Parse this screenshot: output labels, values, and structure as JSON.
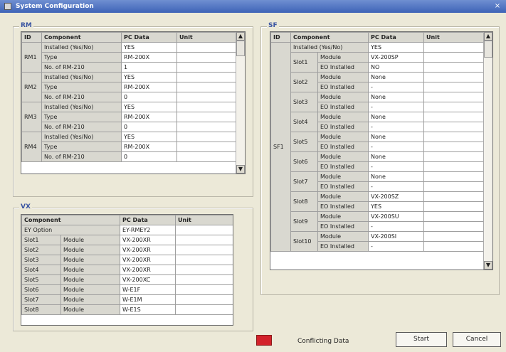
{
  "window": {
    "title": "System Configuration",
    "close_icon": "×"
  },
  "rm": {
    "label": "RM",
    "headers": [
      "ID",
      "Component",
      "PC Data",
      "Unit"
    ],
    "rows": [
      {
        "id": "",
        "component": "Installed (Yes/No)",
        "pc": "YES",
        "unit": ""
      },
      {
        "id": "RM1",
        "component": "Type",
        "pc": "RM-200X",
        "unit": ""
      },
      {
        "id": "",
        "component": "No. of RM-210",
        "pc": "1",
        "unit": ""
      },
      {
        "id": "",
        "component": "Installed (Yes/No)",
        "pc": "YES",
        "unit": ""
      },
      {
        "id": "RM2",
        "component": "Type",
        "pc": "RM-200X",
        "unit": ""
      },
      {
        "id": "",
        "component": "No. of RM-210",
        "pc": "0",
        "unit": ""
      },
      {
        "id": "",
        "component": "Installed (Yes/No)",
        "pc": "YES",
        "unit": ""
      },
      {
        "id": "RM3",
        "component": "Type",
        "pc": "RM-200X",
        "unit": ""
      },
      {
        "id": "",
        "component": "No. of RM-210",
        "pc": "0",
        "unit": ""
      },
      {
        "id": "",
        "component": "Installed (Yes/No)",
        "pc": "YES",
        "unit": ""
      },
      {
        "id": "RM4",
        "component": "Type",
        "pc": "RM-200X",
        "unit": ""
      },
      {
        "id": "",
        "component": "No. of RM-210",
        "pc": "0",
        "unit": ""
      }
    ]
  },
  "vx": {
    "label": "VX",
    "headers": [
      "Component",
      "PC Data",
      "Unit"
    ],
    "rows": [
      {
        "slot": "EY Option",
        "type": "",
        "pc": "EY-RMEY2",
        "unit": ""
      },
      {
        "slot": "Slot1",
        "type": "Module",
        "pc": "VX-200XR",
        "unit": ""
      },
      {
        "slot": "Slot2",
        "type": "Module",
        "pc": "VX-200XR",
        "unit": ""
      },
      {
        "slot": "Slot3",
        "type": "Module",
        "pc": "VX-200XR",
        "unit": ""
      },
      {
        "slot": "Slot4",
        "type": "Module",
        "pc": "VX-200XR",
        "unit": ""
      },
      {
        "slot": "Slot5",
        "type": "Module",
        "pc": "VX-200XC",
        "unit": ""
      },
      {
        "slot": "Slot6",
        "type": "Module",
        "pc": "W-E1F",
        "unit": ""
      },
      {
        "slot": "Slot7",
        "type": "Module",
        "pc": "W-E1M",
        "unit": ""
      },
      {
        "slot": "Slot8",
        "type": "Module",
        "pc": "W-E1S",
        "unit": ""
      }
    ]
  },
  "sf": {
    "label": "SF",
    "headers": [
      "ID",
      "Component",
      "PC Data",
      "Unit"
    ],
    "rows": [
      {
        "id": "SF1",
        "slot": "",
        "comp": "Installed (Yes/No)",
        "pc": "YES",
        "unit": ""
      },
      {
        "id": "",
        "slot": "Slot1",
        "comp": "Module",
        "pc": "VX-200SP",
        "unit": ""
      },
      {
        "id": "",
        "slot": "",
        "comp": "EO Installed",
        "pc": "NO",
        "unit": ""
      },
      {
        "id": "",
        "slot": "Slot2",
        "comp": "Module",
        "pc": "None",
        "unit": ""
      },
      {
        "id": "",
        "slot": "",
        "comp": "EO Installed",
        "pc": "-",
        "unit": ""
      },
      {
        "id": "",
        "slot": "Slot3",
        "comp": "Module",
        "pc": "None",
        "unit": ""
      },
      {
        "id": "",
        "slot": "",
        "comp": "EO Installed",
        "pc": "-",
        "unit": ""
      },
      {
        "id": "",
        "slot": "Slot4",
        "comp": "Module",
        "pc": "None",
        "unit": ""
      },
      {
        "id": "",
        "slot": "",
        "comp": "EO Installed",
        "pc": "-",
        "unit": ""
      },
      {
        "id": "",
        "slot": "Slot5",
        "comp": "Module",
        "pc": "None",
        "unit": ""
      },
      {
        "id": "",
        "slot": "",
        "comp": "EO Installed",
        "pc": "-",
        "unit": ""
      },
      {
        "id": "",
        "slot": "Slot6",
        "comp": "Module",
        "pc": "None",
        "unit": ""
      },
      {
        "id": "",
        "slot": "",
        "comp": "EO Installed",
        "pc": "-",
        "unit": ""
      },
      {
        "id": "",
        "slot": "Slot7",
        "comp": "Module",
        "pc": "None",
        "unit": ""
      },
      {
        "id": "",
        "slot": "",
        "comp": "EO Installed",
        "pc": "-",
        "unit": ""
      },
      {
        "id": "",
        "slot": "Slot8",
        "comp": "Module",
        "pc": "VX-200SZ",
        "unit": ""
      },
      {
        "id": "",
        "slot": "",
        "comp": "EO Installed",
        "pc": "YES",
        "unit": ""
      },
      {
        "id": "",
        "slot": "Slot9",
        "comp": "Module",
        "pc": "VX-200SU",
        "unit": ""
      },
      {
        "id": "",
        "slot": "",
        "comp": "EO Installed",
        "pc": "-",
        "unit": ""
      },
      {
        "id": "",
        "slot": "Slot10",
        "comp": "Module",
        "pc": "VX-200SI",
        "unit": ""
      },
      {
        "id": "",
        "slot": "",
        "comp": "EO Installed",
        "pc": "-",
        "unit": ""
      }
    ]
  },
  "footer": {
    "legend_text": "Conflicting Data",
    "legend_color": "#d3222b",
    "start_label": "Start",
    "cancel_label": "Cancel"
  },
  "icons": {
    "scroll_up": "▲",
    "scroll_down": "▼"
  }
}
